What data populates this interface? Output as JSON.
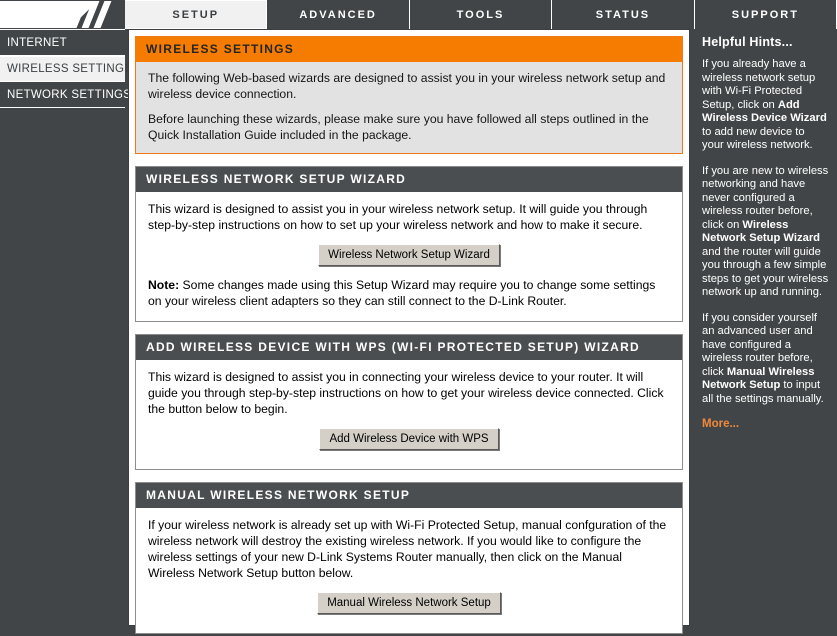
{
  "nav": {
    "tabs": [
      {
        "label": "SETUP",
        "active": true
      },
      {
        "label": "ADVANCED",
        "active": false
      },
      {
        "label": "TOOLS",
        "active": false
      },
      {
        "label": "STATUS",
        "active": false
      },
      {
        "label": "SUPPORT",
        "active": false
      }
    ]
  },
  "sidebar": {
    "items": [
      {
        "label": "INTERNET",
        "selected": false
      },
      {
        "label": "WIRELESS SETTINGS",
        "selected": true
      },
      {
        "label": "NETWORK SETTINGS",
        "selected": false
      }
    ]
  },
  "intro": {
    "title": "WIRELESS SETTINGS",
    "paragraph1": "The following Web-based wizards are designed to assist you in your wireless network setup and wireless device connection.",
    "paragraph2": "Before launching these wizards, please make sure you have followed all steps outlined in the Quick Installation Guide included in the package."
  },
  "section_wizard": {
    "title": "WIRELESS NETWORK SETUP WIZARD",
    "body": "This wizard is designed to assist you in your wireless network setup. It will guide you through step-by-step instructions on how to set up your wireless network and how to make it secure.",
    "button_label": "Wireless Network Setup Wizard",
    "note_label": "Note:",
    "note_text": " Some changes made using this Setup Wizard may require you to change some settings on your wireless client adapters so they can still connect to the D-Link Router."
  },
  "section_wps": {
    "title": "ADD WIRELESS DEVICE WITH WPS (WI-FI PROTECTED SETUP) WIZARD",
    "body": "This wizard is designed to assist you in connecting your wireless device to your router. It will guide you through step-by-step instructions on how to get your wireless device connected. Click the button below to begin.",
    "button_label": "Add Wireless Device with WPS"
  },
  "section_manual": {
    "title": "MANUAL WIRELESS NETWORK SETUP",
    "body": "If your wireless network is already set up with Wi-Fi Protected Setup, manual confguration of the wireless network will destroy the existing wireless network. If you would like to configure the wireless settings of your new D-Link Systems Router manually, then click on the Manual Wireless Network Setup button below.",
    "button_label": "Manual Wireless Network Setup"
  },
  "hints": {
    "title": "Helpful Hints...",
    "hint1_part1": "If you already have a wireless network setup with Wi-Fi Protected Setup, click on ",
    "hint1_bold": "Add Wireless Device Wizard",
    "hint1_part2": " to add new device to your wireless network.",
    "hint2_part1": "If you are new to wireless networking and have never configured a wireless router before, click on ",
    "hint2_bold": "Wireless Network Setup Wizard",
    "hint2_part2": " and the router will guide you through a few simple steps to get your wireless network up and running.",
    "hint3_part1": "If you consider yourself an advanced user and have configured a wireless router before, click ",
    "hint3_bold": "Manual Wireless Network Setup",
    "hint3_part2": " to input all the settings manually.",
    "more_label": "More..."
  },
  "colors": {
    "dark": "#414547",
    "orange": "#f57c00",
    "orange_link": "#f0893a",
    "panel_head": "#4a4e50",
    "intro_body": "#e2e2e2",
    "button_face": "#d4d0c8"
  }
}
